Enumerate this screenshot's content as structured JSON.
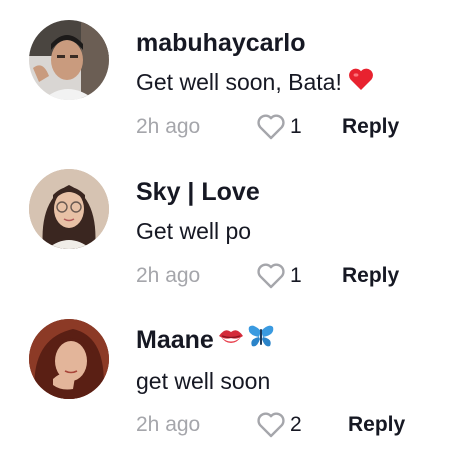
{
  "comments": [
    {
      "username": "mabuhaycarlo",
      "text": "Get well soon, Bata!",
      "text_emoji": "heart-emoji",
      "time": "2h ago",
      "likes": "1",
      "reply_label": "Reply"
    },
    {
      "username": "Sky | Love",
      "text": "Get well po",
      "time": "2h ago",
      "likes": "1",
      "reply_label": "Reply"
    },
    {
      "username": "Maane",
      "username_emojis": [
        "kiss-mark-emoji",
        "butterfly-emoji"
      ],
      "text": "get well soon",
      "time": "2h ago",
      "likes": "2",
      "reply_label": "Reply"
    }
  ],
  "colors": {
    "text_primary": "#161823",
    "text_secondary": "#a5a6ab",
    "heart_emoji": "#e8222f",
    "kiss_emoji": "#d42a3a",
    "butterfly_emoji": "#3a9ae0",
    "background": "#ffffff"
  }
}
